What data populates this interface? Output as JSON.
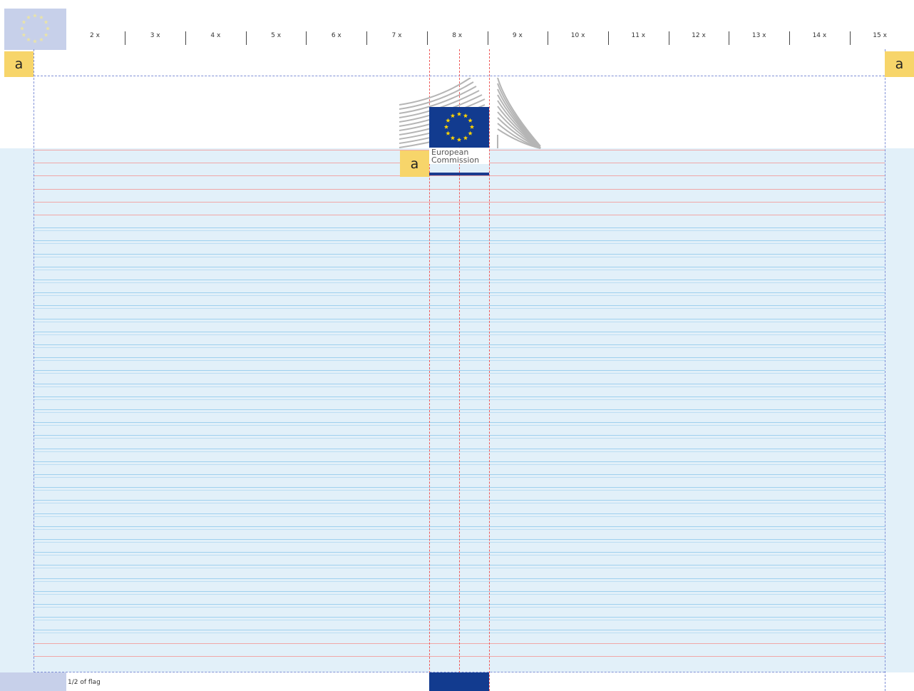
{
  "ruler": {
    "labels": [
      "2 x",
      "3 x",
      "4 x",
      "5 x",
      "6 x",
      "7 x",
      "8 x",
      "9 x",
      "10 x",
      "11 x",
      "12 x",
      "13 x",
      "14 x",
      "15 x"
    ]
  },
  "margin_marker": {
    "label": "a"
  },
  "logo": {
    "line1": "European",
    "line2": "Commission"
  },
  "footer": {
    "label": "1/2 of flag"
  },
  "colors": {
    "margin_marker": "#f7d56a",
    "eu_blue": "#123b8f",
    "eu_yellow": "#ffd400",
    "band": "#e2f0f9"
  }
}
